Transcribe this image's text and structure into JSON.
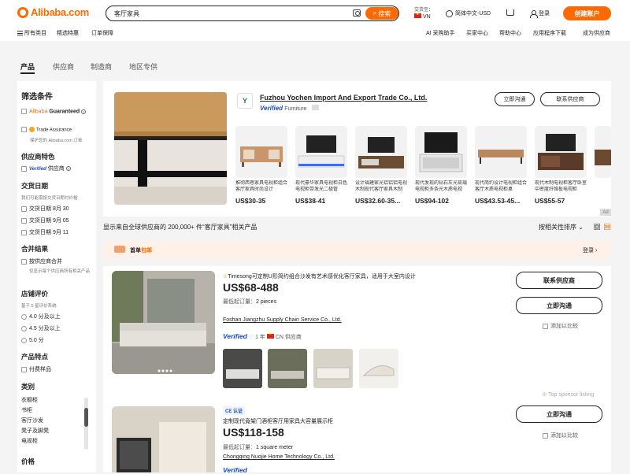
{
  "header": {
    "logo_text": "Alibaba.com",
    "search_value": "客厅家具",
    "search_button": "搜索",
    "deliver_label": "交货至：",
    "deliver_country": "VN",
    "language_currency": "简体中文-USD",
    "signin": "登录",
    "signup": "创建账户",
    "subnav_left": [
      "所有类目",
      "精选特惠",
      "订单保障"
    ],
    "subnav_right": [
      "AI 采购助手",
      "买家中心",
      "帮助中心",
      "应用程序下载",
      "成为供应商"
    ]
  },
  "tabs": [
    "产品",
    "供应商",
    "制造商",
    "地区专供"
  ],
  "sidebar": {
    "title": "筛选条件",
    "guaranteed_prefix": "Alibaba",
    "guaranteed_suffix": "Guaranteed",
    "trade_assurance": "Trade Assurance",
    "trade_assurance_sub": "保护您的 Alibaba.com 订单",
    "supplier_features": "供应商特色",
    "verified_supplier": "Verified 供应商",
    "delivery_date": "交货日期",
    "delivery_sub": "我们可能需按交货日期付价格",
    "delivery_options": [
      "交货日期 8月 30",
      "交货日期 9月 05",
      "交货日期 9月 11"
    ],
    "merge_results": "合并结果",
    "merge_option": "按供应商合并",
    "merge_sub": "仅显示每个供应商所有相关产品",
    "store_rating": "店铺评价",
    "rating_sub": "基于 5 星评价系统",
    "rating_options": [
      "4.0 分及以上",
      "4.5 分及以上",
      "5.0 分"
    ],
    "product_features": "产品特点",
    "paid_samples": "付费样品",
    "category": "类别",
    "categories": [
      "衣橱柜",
      "书柜",
      "客厅沙发",
      "凳子及脚凳",
      "电视柜"
    ],
    "price": "价格"
  },
  "sponsor": {
    "company": "Fuzhou Yochen Import And Export Trade Co., Ltd.",
    "verified": "Verified",
    "category": "Furniture",
    "chat_button": "立即沟通",
    "contact_button": "联系供应商",
    "products": [
      {
        "caption": "推彻西巷家具电视柜组合客厅家具时尚设计",
        "price": "US$30-35"
      },
      {
        "caption": "现代豪华家具电视柜白色电视柜带发光二极管",
        "price": "US$38-41"
      },
      {
        "caption": "设计福建家光铝铝铝电视木制现代客厅家具木制",
        "price": "US$32.60-35..."
      },
      {
        "caption": "现代发现的钻石灰光琉璃电视柜多条光木质电视",
        "price": "US$94-102"
      },
      {
        "caption": "现代简约设计电视柜组合客厅木质电视柜桌",
        "price": "US$43.53-45..."
      },
      {
        "caption": "现代木制电视柜客厅卧室中密度纤维板电视柜",
        "price": "US$55-57"
      }
    ],
    "ad_label": "Ad"
  },
  "results": {
    "text": "显示来自全球供应商的 200,000+ 件“客厅家具”相关产品",
    "sort_label": "按相关性排序"
  },
  "banner": {
    "label_black": "首单",
    "label_orange": "包邮",
    "signin": "登录"
  },
  "listings": [
    {
      "title_prefix": "Timesong",
      "title": "可定制U形简约组合沙发有艺术感优化客厅家具，适用于大室内设计",
      "price": "US$68-488",
      "moq_label": "最低起订量：",
      "moq": "2 pieces",
      "supplier": "Foshan Jiangzhu Supply Chain Service Co., Ltd.",
      "verified": "Verified",
      "years": "1 年",
      "country": "CN 供应商",
      "contact_button": "联系供应商",
      "chat_button": "立即沟通",
      "compare": "添加以比较",
      "top_sponsor": "Top sponsor listing"
    },
    {
      "badge": "CE 认证",
      "title": "定制现代竟架门酒柜客厅用家具大容量展示柜",
      "price": "US$118-158",
      "moq_label": "最低起订量：",
      "moq": "1 square meter",
      "supplier": "Chongqing Nuojie Home Technology Co., Ltd.",
      "verified": "Verified",
      "chat_button": "立即沟通",
      "compare": "添加以比较"
    }
  ],
  "colors": {
    "brand": "#ff6a00",
    "verified": "#1b4fb6"
  }
}
